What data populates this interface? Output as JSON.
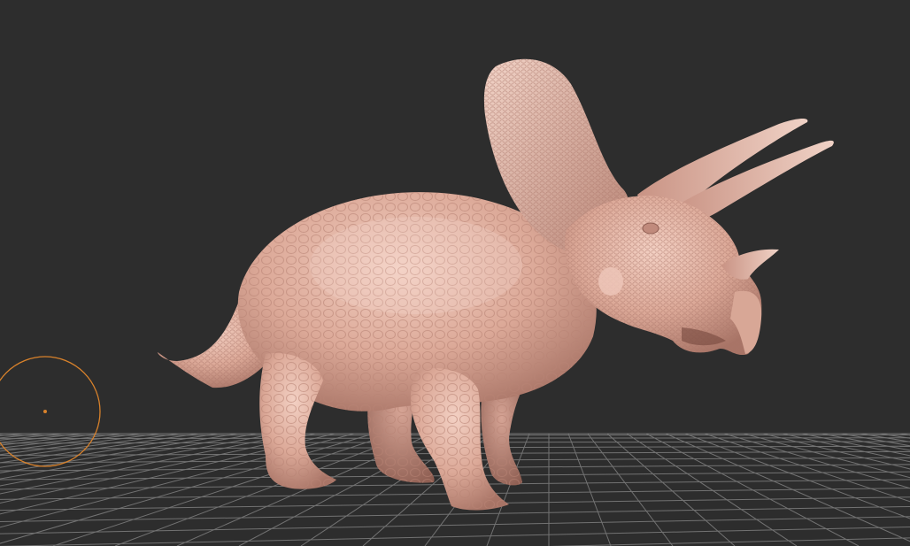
{
  "viewport": {
    "background": "#2d2d2d",
    "floor_grid_color": "#8a8a8a",
    "brush_cursor_color": "#d9822b"
  },
  "scene": {
    "model": "triceratops-sculpt",
    "model_color": "#e6b8a8",
    "model_shadow_color": "#b07f72",
    "icons": [
      "brush-cursor-icon",
      "floor-grid-icon"
    ]
  }
}
